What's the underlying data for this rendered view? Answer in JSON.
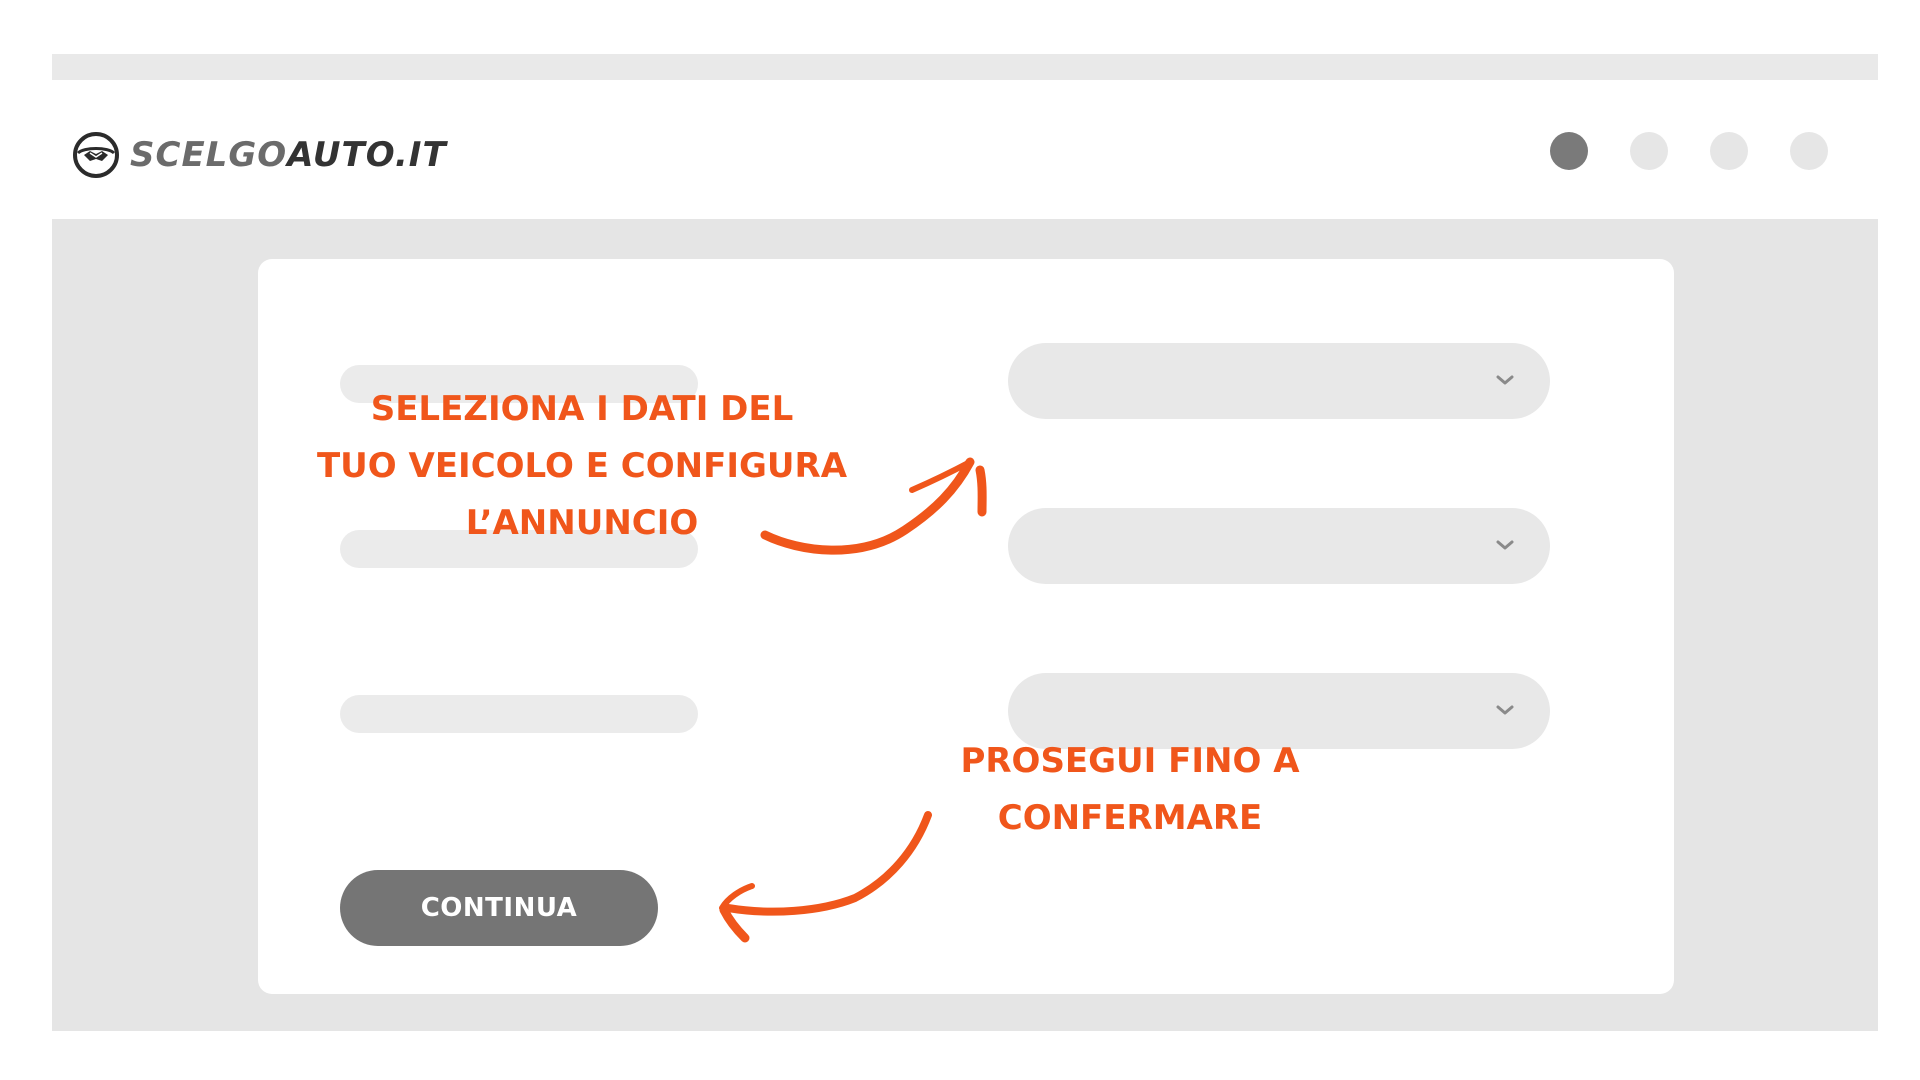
{
  "header": {
    "logo": {
      "text_light": "SCELGO",
      "text_bold": "AUTO.IT",
      "icon": "handshake-steering-wheel-icon"
    },
    "steps": {
      "total": 4,
      "current": 1
    }
  },
  "form": {
    "selects": [
      {
        "icon": "chevron-down-icon"
      },
      {
        "icon": "chevron-down-icon"
      },
      {
        "icon": "chevron-down-icon"
      }
    ],
    "continue_label": "CONTINUA"
  },
  "annotations": {
    "note_1": [
      "SELEZIONA I DATI DEL",
      "TUO VEICOLO E CONFIGURA",
      "L’ANNUNCIO"
    ],
    "note_2": [
      "PROSEGUI FINO A",
      "CONFERMARE"
    ]
  },
  "colors": {
    "accent": "#f0561b",
    "button": "#757575",
    "active_step": "#7a7a7a",
    "inactive_step": "#e6e6e6",
    "background": "#e5e5e5"
  }
}
